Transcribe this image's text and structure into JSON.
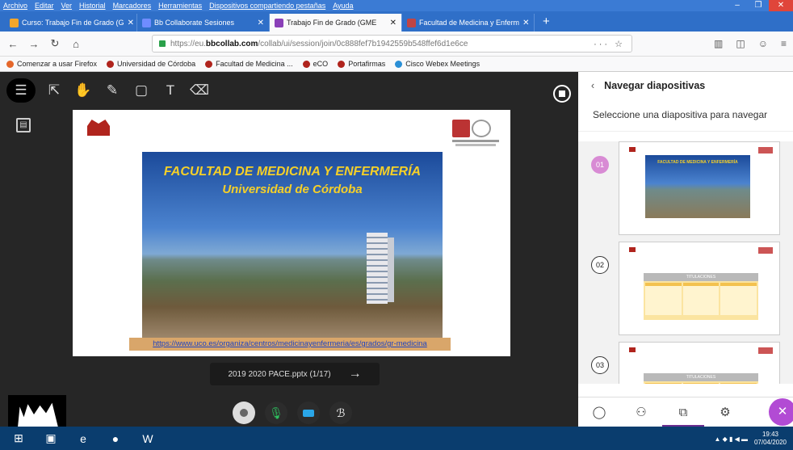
{
  "menu": [
    "Archivo",
    "Editar",
    "Ver",
    "Historial",
    "Marcadores",
    "Herramientas",
    "Dispositivos compartiendo pestañas",
    "Ayuda"
  ],
  "window_controls": [
    "–",
    "❐",
    "✕"
  ],
  "tabs": [
    {
      "title": "Curso: Trabajo Fin de Grado (G",
      "fav_color": "#f4a62a",
      "close": "✕"
    },
    {
      "title": "Bb Collaborate Sesiones",
      "fav_color": "#6f8cff",
      "close": "✕"
    },
    {
      "title": "Trabajo Fin de Grado (GME",
      "fav_color": "#8a3fb8",
      "close": "✕"
    },
    {
      "title": "Facultad de Medicina y Enferm",
      "fav_color": "#c04545",
      "close": "✕"
    }
  ],
  "new_tab": "+",
  "nav": {
    "back": "←",
    "forward": "→",
    "reload": "↻",
    "home": "⌂"
  },
  "url": {
    "prefix": "https://eu.",
    "domain": "bbcollab.com",
    "path": "/collab/ui/session/join/0c888fef7b1942559b548ffef6d1e6ce",
    "actions": "··· ☆",
    "right_icons": [
      "▥",
      "◫",
      "☺",
      "≡"
    ]
  },
  "bookmarks": [
    {
      "label": "Comenzar a usar Firefox",
      "color": "#e5672b"
    },
    {
      "label": "Universidad de Córdoba",
      "color": "#b0241d"
    },
    {
      "label": "Facultad de Medicina ...",
      "color": "#b0241d"
    },
    {
      "label": "eCO",
      "color": "#b0241d"
    },
    {
      "label": "Portafirmas",
      "color": "#b0241d"
    },
    {
      "label": "Cisco Webex Meetings",
      "color": "#2a8fd6"
    }
  ],
  "tools": [
    "☰",
    "⇱",
    "✋",
    "✎",
    "▢",
    "T",
    "⌫"
  ],
  "sideicon": "▤",
  "slide": {
    "title1": "FACULTAD DE MEDICINA Y ENFERMERÍA",
    "title2": "Universidad de Córdoba",
    "link": "https://www.uco.es/organiza/centros/medicinayenfermeria/es/grados/gr-medicina"
  },
  "pager": {
    "label": "2019 2020 PACE.pptx",
    "position": "(1/17)",
    "arrow": "→"
  },
  "panel": {
    "back": "‹",
    "title": "Navegar diapositivas",
    "subtitle": "Seleccione una diapositiva para navegar",
    "slides": [
      {
        "num": "01",
        "selected": true,
        "kind": "photo",
        "mini_title": "FACULTAD DE MEDICINA Y ENFERMERÍA"
      },
      {
        "num": "02",
        "selected": false,
        "kind": "table",
        "mini_title": "TITULACIONES"
      },
      {
        "num": "03",
        "selected": false,
        "kind": "table",
        "mini_title": "TITULACIONES"
      }
    ],
    "footer": [
      "◯",
      "⚇",
      "⧉",
      "⚙",
      "✕"
    ]
  },
  "controls": {
    "avatar": "●",
    "mic": "🎙",
    "cam": "■",
    "share": "ℬ"
  },
  "taskbar": {
    "items": [
      "⊞",
      "▣",
      "e",
      "●",
      "W"
    ],
    "tray": "▲ ◆ ▮ ◀ ▬",
    "time": "19:43",
    "date": "07/04/2020"
  }
}
